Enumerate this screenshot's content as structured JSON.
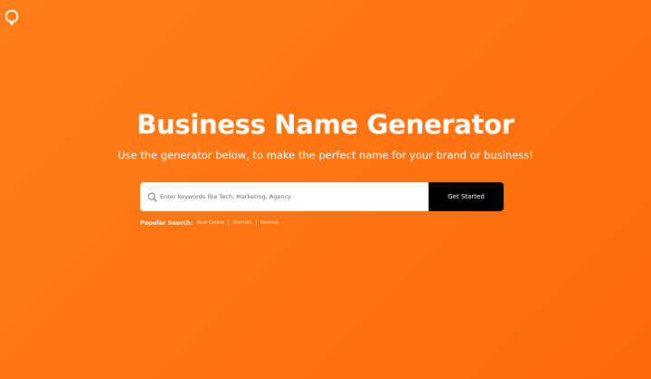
{
  "colors": {
    "background": "#ff7514",
    "button_bg": "#000000",
    "text": "#ffffff"
  },
  "logo": {
    "icon": "location-pin-logo-icon"
  },
  "hero": {
    "title": "Business Name Generator",
    "subtitle": "Use the generator below, to make the perfect name for your brand or business!"
  },
  "search": {
    "icon": "search-icon",
    "placeholder": "Enter keywords like Tech, Marketing, Agency",
    "value": "",
    "button_label": "Get Started"
  },
  "popular": {
    "label": "Popular Search:",
    "tags": [
      "Real Estate",
      "Domain",
      "Startup"
    ]
  }
}
